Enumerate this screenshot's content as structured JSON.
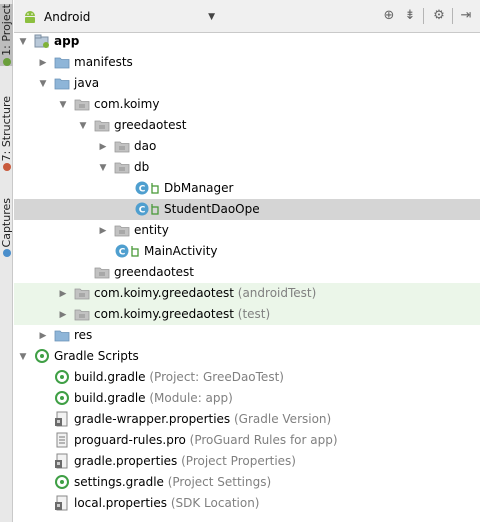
{
  "side_tabs": [
    {
      "label": "1: Project"
    },
    {
      "label": "7: Structure"
    },
    {
      "label": "Captures"
    }
  ],
  "toolbar": {
    "view_selector": "Android",
    "icons": [
      "target-icon",
      "collapse-all-icon",
      "gear-icon",
      "hide-panel-icon"
    ]
  },
  "tree": [
    {
      "name": "app",
      "bold": true,
      "hint": "",
      "icon": "module",
      "depth": 0,
      "expanded": true
    },
    {
      "name": "manifests",
      "hint": "",
      "icon": "folder",
      "depth": 1,
      "expanded": false
    },
    {
      "name": "java",
      "hint": "",
      "icon": "folder",
      "depth": 1,
      "expanded": true
    },
    {
      "name": "com.koimy",
      "hint": "",
      "icon": "package",
      "depth": 2,
      "expanded": true
    },
    {
      "name": "greedaotest",
      "hint": "",
      "icon": "package",
      "depth": 3,
      "expanded": true
    },
    {
      "name": "dao",
      "hint": "",
      "icon": "package",
      "depth": 4,
      "expanded": false
    },
    {
      "name": "db",
      "hint": "",
      "icon": "package",
      "depth": 4,
      "expanded": true
    },
    {
      "name": "DbManager",
      "hint": "",
      "icon": "class",
      "depth": 5
    },
    {
      "name": "StudentDaoOpe",
      "hint": "",
      "icon": "class",
      "depth": 5,
      "selected": true
    },
    {
      "name": "entity",
      "hint": "",
      "icon": "package",
      "depth": 4,
      "expanded": false
    },
    {
      "name": "MainActivity",
      "hint": "",
      "icon": "class",
      "depth": 4
    },
    {
      "name": "greendaotest",
      "hint": "",
      "icon": "package",
      "depth": 3
    },
    {
      "name": "com.koimy.greedaotest",
      "hint": "(androidTest)",
      "icon": "package",
      "depth": 2,
      "expanded": false,
      "test": true
    },
    {
      "name": "com.koimy.greedaotest",
      "hint": "(test)",
      "icon": "package",
      "depth": 2,
      "expanded": false,
      "test": true
    },
    {
      "name": "res",
      "hint": "",
      "icon": "folder",
      "depth": 1,
      "expanded": false
    },
    {
      "name": "Gradle Scripts",
      "hint": "",
      "icon": "gradle",
      "depth": 0,
      "expanded": true
    },
    {
      "name": "build.gradle",
      "hint": "(Project: GreeDaoTest)",
      "icon": "gradle",
      "depth": 1
    },
    {
      "name": "build.gradle",
      "hint": "(Module: app)",
      "icon": "gradle",
      "depth": 1
    },
    {
      "name": "gradle-wrapper.properties",
      "hint": "(Gradle Version)",
      "icon": "properties",
      "depth": 1
    },
    {
      "name": "proguard-rules.pro",
      "hint": "(ProGuard Rules for app)",
      "icon": "text-file",
      "depth": 1
    },
    {
      "name": "gradle.properties",
      "hint": "(Project Properties)",
      "icon": "properties",
      "depth": 1
    },
    {
      "name": "settings.gradle",
      "hint": "(Project Settings)",
      "icon": "gradle",
      "depth": 1
    },
    {
      "name": "local.properties",
      "hint": "(SDK Location)",
      "icon": "properties",
      "depth": 1
    }
  ],
  "colors": {
    "folder": "#8eb5d8",
    "package": "#c2c2c2",
    "class": "#4f9fcf",
    "gradle": "#3f9f45",
    "test_row": "#ebf6e9",
    "selected_row": "#d5d5d5"
  }
}
